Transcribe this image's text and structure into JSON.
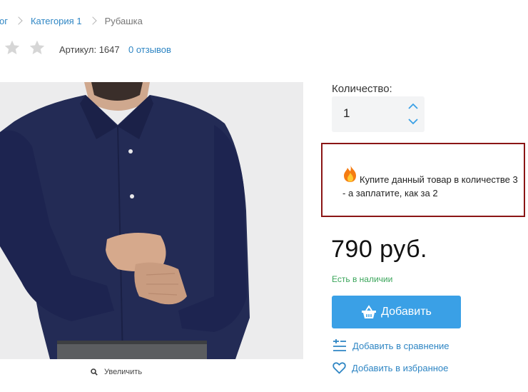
{
  "breadcrumb": {
    "items": [
      {
        "label": "алог"
      },
      {
        "label": "Категория 1"
      }
    ],
    "current": "Рубашка"
  },
  "rating": {
    "stars_filled": 0,
    "stars_total": 5
  },
  "sku": {
    "label": "Артикул:",
    "value": "1647"
  },
  "reviews_link": "0 отзывов",
  "zoom_label": "Увеличить",
  "quantity": {
    "label": "Количество:",
    "value": "1"
  },
  "promo": {
    "text": "Купите данный товар в количестве 3 - а заплатите, как за 2",
    "border_color": "#8b1515"
  },
  "price": "790 руб.",
  "stock_status": "Есть в наличии",
  "add_button": {
    "label": "Добавить",
    "color": "#3aa0e6"
  },
  "compare_link": "Добавить в сравнение",
  "favorite_link": "Добавить в избранное",
  "colors": {
    "link": "#2f86c4",
    "in_stock": "#3aa55a"
  }
}
